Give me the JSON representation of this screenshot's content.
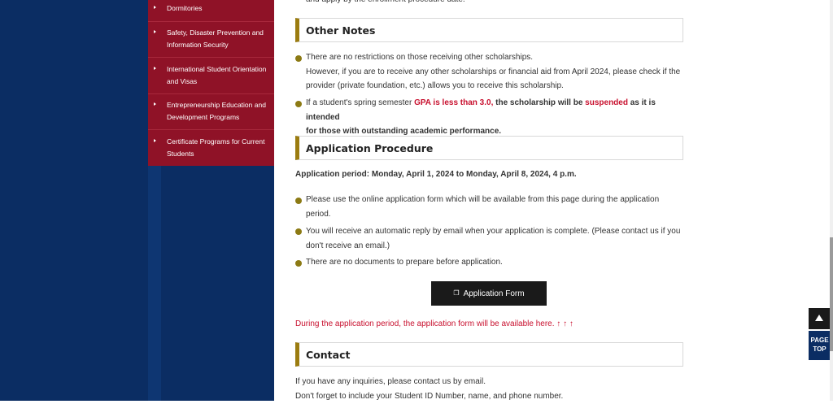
{
  "sidebar": {
    "items": [
      {
        "label": "Dormitories"
      },
      {
        "label": "Safety, Disaster Prevention and Information Security"
      },
      {
        "label": "International Student Orientation and Visas"
      },
      {
        "label": "Entrepreneurship Education and Development Programs"
      },
      {
        "label": "Certificate Programs for Current Students"
      }
    ]
  },
  "top_fragment": "and apply by the enrollment procedure date.",
  "other_notes": {
    "heading": "Other Notes",
    "b1_l1": "There are no restrictions on those receiving other scholarships.",
    "b1_l2": "However, if you are to receive any other scholarships or financial aid from April 2024, please check if the",
    "b1_l3": "provider (private foundation, etc.) allows you to receive this scholarship.",
    "b2_p1": "If a student's spring semester ",
    "b2_red1": "GPA is less than 3.0,",
    "b2_p2": " the scholarship will be ",
    "b2_red2": "suspended",
    "b2_p3": " as it is intended",
    "b2_l2": "for those with outstanding academic performance."
  },
  "application": {
    "heading": "Application Procedure",
    "period": "Application period: Monday, April 1, 2024 to Monday, April 8, 2024, 4 p.m.",
    "b1_l1": "Please use the online application form which will be available from this page during the application",
    "b1_l2": "period.",
    "b2_l1": "You will receive an automatic reply by email when your application is complete. (Please contact us if you",
    "b2_l2": "don't receive an email.)",
    "b3": "There are no documents to prepare before application.",
    "button_label": "Application Form",
    "notice": "During the application period, the application form will be available here. ↑ ↑ ↑"
  },
  "contact": {
    "heading": "Contact",
    "line1": "If you have any inquiries, please contact us by email.",
    "line2": "Don't forget to include your Student ID Number, name, and phone number."
  },
  "page_top": {
    "label": "PAGE TOP"
  }
}
